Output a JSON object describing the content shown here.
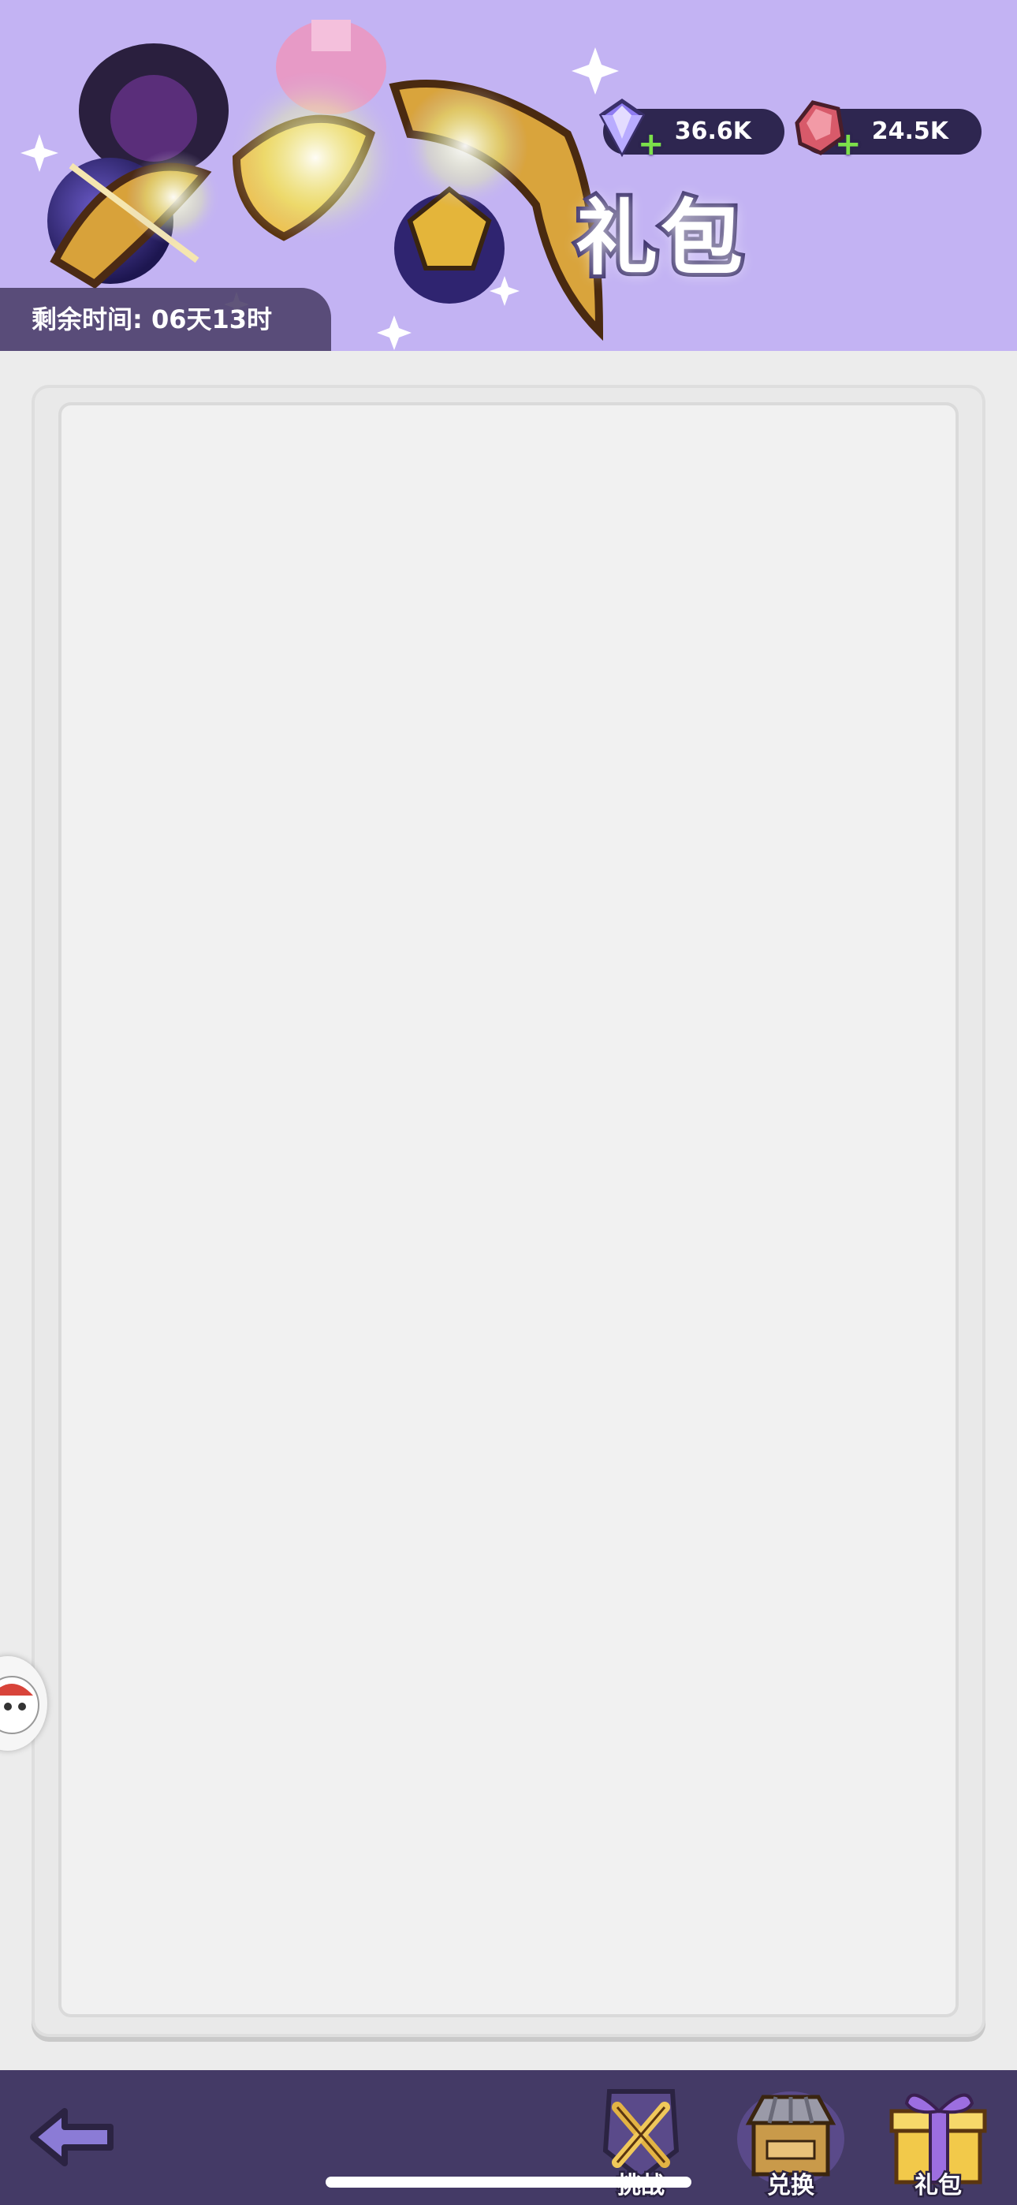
{
  "header": {
    "title": "礼包",
    "timer_text": "剩余时间: 06天13时",
    "background_color": "#c3b3f3"
  },
  "currencies": {
    "gem": {
      "amount": "36.6K",
      "icon": "purple-diamond-icon"
    },
    "crystal": {
      "amount": "24.5K",
      "icon": "red-crystal-icon"
    }
  },
  "bottom_nav": {
    "back_icon": "back-arrow-icon",
    "tabs": [
      {
        "label": "挑战",
        "icon": "crossed-swords-icon"
      },
      {
        "label": "兑换",
        "icon": "shop-icon"
      },
      {
        "label": "礼包",
        "icon": "gift-box-icon"
      }
    ],
    "background_color": "#443a66"
  }
}
